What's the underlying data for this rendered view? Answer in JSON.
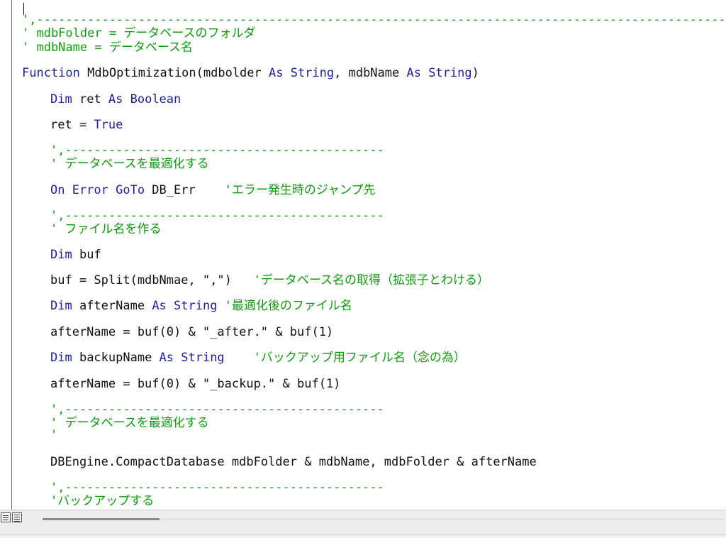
{
  "editor": {
    "lines": [
      {
        "tokens": [
          {
            "t": "',--------------------------------------------------------------------------------------------------",
            "c": "cm"
          }
        ]
      },
      {
        "tokens": [
          {
            "t": "' mdbFolder = データベースのフォルダ",
            "c": "cm"
          }
        ]
      },
      {
        "tokens": [
          {
            "t": "' mdbName = データベース名",
            "c": "cm"
          }
        ]
      },
      {
        "tokens": [
          {
            "t": "Function",
            "c": "kw"
          },
          {
            "t": " MdbOptimization(mdbolder ",
            "c": "tx"
          },
          {
            "t": "As String",
            "c": "kw"
          },
          {
            "t": ", mdbName ",
            "c": "tx"
          },
          {
            "t": "As String",
            "c": "kw"
          },
          {
            "t": ")",
            "c": "tx"
          }
        ]
      },
      {
        "tokens": [
          {
            "t": "Dim",
            "c": "kw"
          },
          {
            "t": " ret ",
            "c": "tx"
          },
          {
            "t": "As Boolean",
            "c": "kw"
          }
        ]
      },
      {
        "tokens": [
          {
            "t": "ret = ",
            "c": "tx"
          },
          {
            "t": "True",
            "c": "kw"
          }
        ]
      },
      {
        "tokens": [
          {
            "t": "',--------------------------------------------",
            "c": "cm"
          }
        ]
      },
      {
        "tokens": [
          {
            "t": "' データベースを最適化する",
            "c": "cm"
          }
        ]
      },
      {
        "tokens": [
          {
            "t": "On Error GoTo",
            "c": "kw"
          },
          {
            "t": " DB_Err    ",
            "c": "tx"
          },
          {
            "t": "'エラー発生時のジャンプ先",
            "c": "cm"
          }
        ]
      },
      {
        "tokens": [
          {
            "t": "',--------------------------------------------",
            "c": "cm"
          }
        ]
      },
      {
        "tokens": [
          {
            "t": "' ファイル名を作る",
            "c": "cm"
          }
        ]
      },
      {
        "tokens": [
          {
            "t": "Dim",
            "c": "kw"
          },
          {
            "t": " buf",
            "c": "tx"
          }
        ]
      },
      {
        "tokens": [
          {
            "t": "buf = Split(mdbNmae, \",\")   ",
            "c": "tx"
          },
          {
            "t": "'データベース名の取得（拡張子とわける）",
            "c": "cm"
          }
        ]
      },
      {
        "tokens": [
          {
            "t": "Dim",
            "c": "kw"
          },
          {
            "t": " afterName ",
            "c": "tx"
          },
          {
            "t": "As String",
            "c": "kw"
          },
          {
            "t": " ",
            "c": "tx"
          },
          {
            "t": "'最適化後のファイル名",
            "c": "cm"
          }
        ]
      },
      {
        "tokens": [
          {
            "t": "afterName = buf(0) & \"_after.\" & buf(1)",
            "c": "tx"
          }
        ]
      },
      {
        "tokens": [
          {
            "t": "Dim",
            "c": "kw"
          },
          {
            "t": " backupName ",
            "c": "tx"
          },
          {
            "t": "As String",
            "c": "kw"
          },
          {
            "t": "    ",
            "c": "tx"
          },
          {
            "t": "'バックアップ用ファイル名（念の為）",
            "c": "cm"
          }
        ]
      },
      {
        "tokens": [
          {
            "t": "afterName = buf(0) & \"_backup.\" & buf(1)",
            "c": "tx"
          }
        ]
      },
      {
        "tokens": [
          {
            "t": "',--------------------------------------------",
            "c": "cm"
          }
        ]
      },
      {
        "tokens": [
          {
            "t": "' データベースを最適化する",
            "c": "cm"
          }
        ]
      },
      {
        "tokens": [
          {
            "t": "'",
            "c": "cm"
          }
        ]
      },
      {
        "tokens": [
          {
            "t": "DBEngine.CompactDatabase mdbFolder & mdbName, mdbFolder & afterName",
            "c": "tx"
          }
        ]
      },
      {
        "tokens": [
          {
            "t": "',--------------------------------------------",
            "c": "cm"
          }
        ]
      },
      {
        "tokens": [
          {
            "t": "'バックアップする",
            "c": "cm"
          }
        ]
      }
    ]
  },
  "status_bar": {
    "procedure_view_icon": "procedure-view-icon",
    "full_module_view_icon": "full-module-view-icon"
  },
  "colors": {
    "keyword": "#1f1f9a",
    "comment": "#119911",
    "text": "#111111"
  }
}
